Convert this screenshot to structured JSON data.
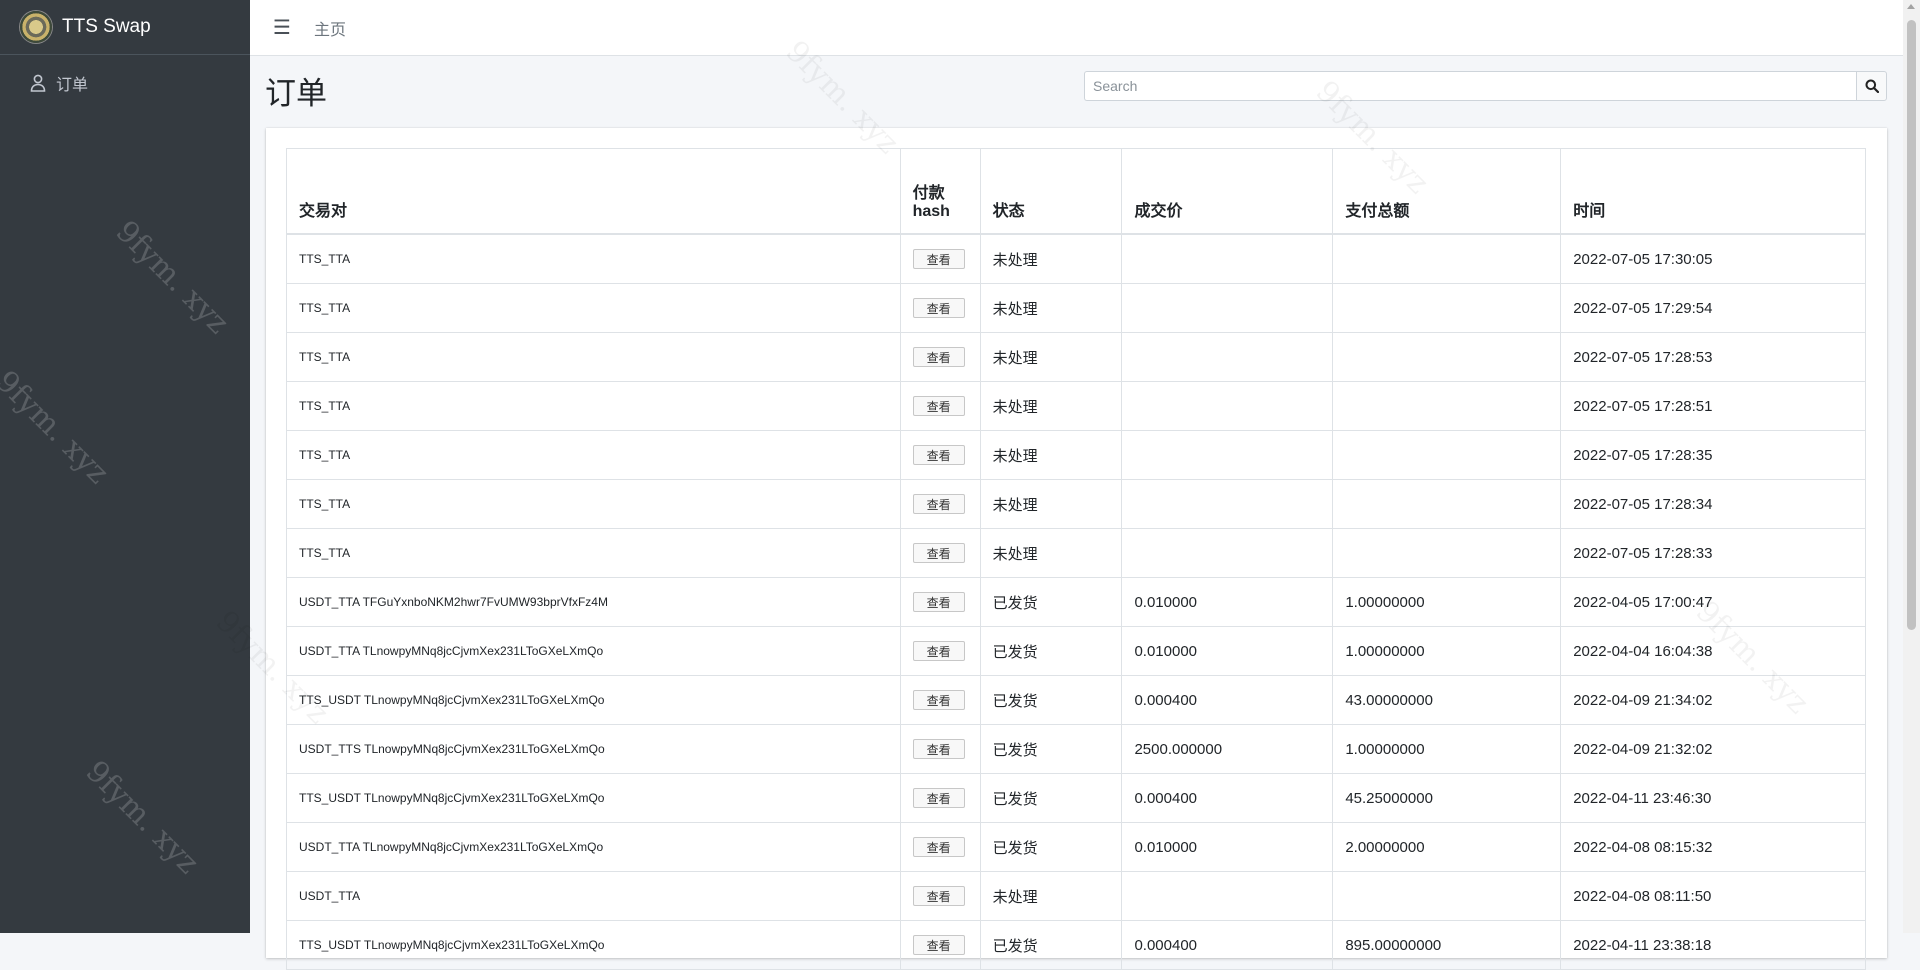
{
  "app": {
    "brand": "TTS Swap"
  },
  "sidebar": {
    "items": [
      {
        "label": "订单",
        "icon": "user-icon"
      }
    ]
  },
  "topbar": {
    "home_label": "主页"
  },
  "page": {
    "title": "订单"
  },
  "search": {
    "placeholder": "Search"
  },
  "table": {
    "headers": [
      "交易对",
      "付款hash",
      "状态",
      "成交价",
      "支付总额",
      "时间"
    ],
    "header_line1": "付款",
    "header_line2": "hash",
    "view_label": "查看",
    "rows": [
      {
        "pair": "TTS_TTA",
        "status": "未处理",
        "price": "",
        "total": "",
        "time": "2022-07-05 17:30:05"
      },
      {
        "pair": "TTS_TTA",
        "status": "未处理",
        "price": "",
        "total": "",
        "time": "2022-07-05 17:29:54"
      },
      {
        "pair": "TTS_TTA",
        "status": "未处理",
        "price": "",
        "total": "",
        "time": "2022-07-05 17:28:53"
      },
      {
        "pair": "TTS_TTA",
        "status": "未处理",
        "price": "",
        "total": "",
        "time": "2022-07-05 17:28:51"
      },
      {
        "pair": "TTS_TTA",
        "status": "未处理",
        "price": "",
        "total": "",
        "time": "2022-07-05 17:28:35"
      },
      {
        "pair": "TTS_TTA",
        "status": "未处理",
        "price": "",
        "total": "",
        "time": "2022-07-05 17:28:34"
      },
      {
        "pair": "TTS_TTA",
        "status": "未处理",
        "price": "",
        "total": "",
        "time": "2022-07-05 17:28:33"
      },
      {
        "pair": "USDT_TTA TFGuYxnboNKM2hwr7FvUMW93bprVfxFz4M",
        "status": "已发货",
        "price": "0.010000",
        "total": "1.00000000",
        "time": "2022-04-05 17:00:47"
      },
      {
        "pair": "USDT_TTA TLnowpyMNq8jcCjvmXex231LToGXeLXmQo",
        "status": "已发货",
        "price": "0.010000",
        "total": "1.00000000",
        "time": "2022-04-04 16:04:38"
      },
      {
        "pair": "TTS_USDT TLnowpyMNq8jcCjvmXex231LToGXeLXmQo",
        "status": "已发货",
        "price": "0.000400",
        "total": "43.00000000",
        "time": "2022-04-09 21:34:02"
      },
      {
        "pair": "USDT_TTS TLnowpyMNq8jcCjvmXex231LToGXeLXmQo",
        "status": "已发货",
        "price": "2500.000000",
        "total": "1.00000000",
        "time": "2022-04-09 21:32:02"
      },
      {
        "pair": "TTS_USDT TLnowpyMNq8jcCjvmXex231LToGXeLXmQo",
        "status": "已发货",
        "price": "0.000400",
        "total": "45.25000000",
        "time": "2022-04-11 23:46:30"
      },
      {
        "pair": "USDT_TTA TLnowpyMNq8jcCjvmXex231LToGXeLXmQo",
        "status": "已发货",
        "price": "0.010000",
        "total": "2.00000000",
        "time": "2022-04-08 08:15:32"
      },
      {
        "pair": "USDT_TTA",
        "status": "未处理",
        "price": "",
        "total": "",
        "time": "2022-04-08 08:11:50"
      },
      {
        "pair": "TTS_USDT TLnowpyMNq8jcCjvmXex231LToGXeLXmQo",
        "status": "已发货",
        "price": "0.000400",
        "total": "895.00000000",
        "time": "2022-04-11 23:38:18"
      }
    ]
  },
  "watermark": "9fym. xyz",
  "colors": {
    "sidebar_bg": "#343a40",
    "content_bg": "#f4f6f9"
  }
}
